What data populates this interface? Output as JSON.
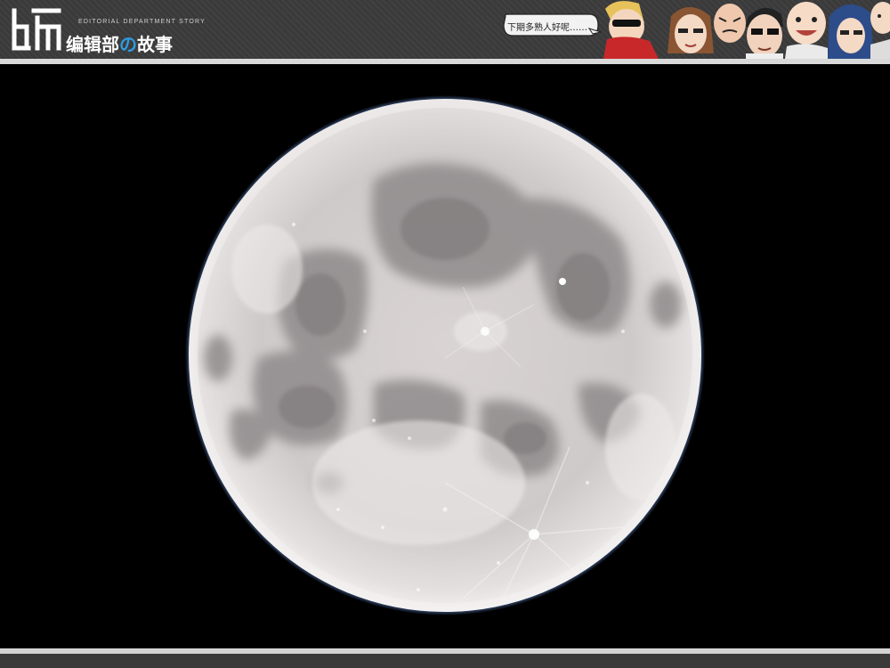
{
  "header": {
    "logo_glyph_icon": "bian-character-logo-icon",
    "subtitle": "EDITORIAL DEPARTMENT STORY",
    "title_part1": "编辑部",
    "title_no": "の",
    "title_part2": "故事",
    "speech_bubble_text": "下期多熟人好呢……",
    "characters_icon": "cartoon-staff-faces-icon"
  },
  "photo": {
    "subject_icon": "full-moon-image"
  },
  "colors": {
    "header_bg": "#3a3a3a",
    "accent": "#2f9be0",
    "divider": "#d9d9d9",
    "photo_bg": "#000000"
  }
}
